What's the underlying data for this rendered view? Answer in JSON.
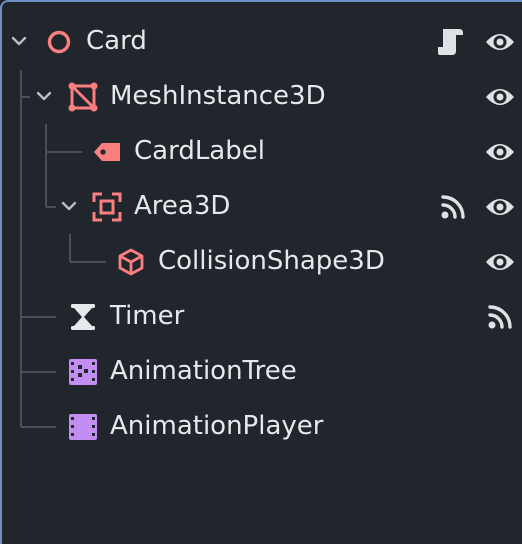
{
  "scene_tree": {
    "nodes": [
      {
        "name": "Card",
        "icon": "node3d-circle-icon",
        "expanded": true,
        "badges": [
          "script-icon",
          "visibility-eye-icon"
        ]
      },
      {
        "name": "MeshInstance3D",
        "icon": "mesh-instance-icon",
        "expanded": true,
        "badges": [
          "visibility-eye-icon"
        ]
      },
      {
        "name": "CardLabel",
        "icon": "label3d-tag-icon",
        "badges": [
          "visibility-eye-icon"
        ]
      },
      {
        "name": "Area3D",
        "icon": "area3d-icon",
        "expanded": true,
        "badges": [
          "signal-icon",
          "visibility-eye-icon"
        ]
      },
      {
        "name": "CollisionShape3D",
        "icon": "collision-shape-cube-icon",
        "badges": [
          "visibility-eye-icon"
        ]
      },
      {
        "name": "Timer",
        "icon": "hourglass-icon",
        "badges": [
          "signal-icon"
        ]
      },
      {
        "name": "AnimationTree",
        "icon": "animation-tree-icon",
        "badges": []
      },
      {
        "name": "AnimationPlayer",
        "icon": "animation-player-icon",
        "badges": []
      }
    ]
  },
  "colors": {
    "background": "#21252c",
    "text": "#e6e8ec",
    "node3d": "#fc7f7f",
    "animation": "#c38ef1",
    "guides": "#4a4f58",
    "icon_light": "#dfe1e5",
    "border_accent": "#6c8fc4"
  }
}
